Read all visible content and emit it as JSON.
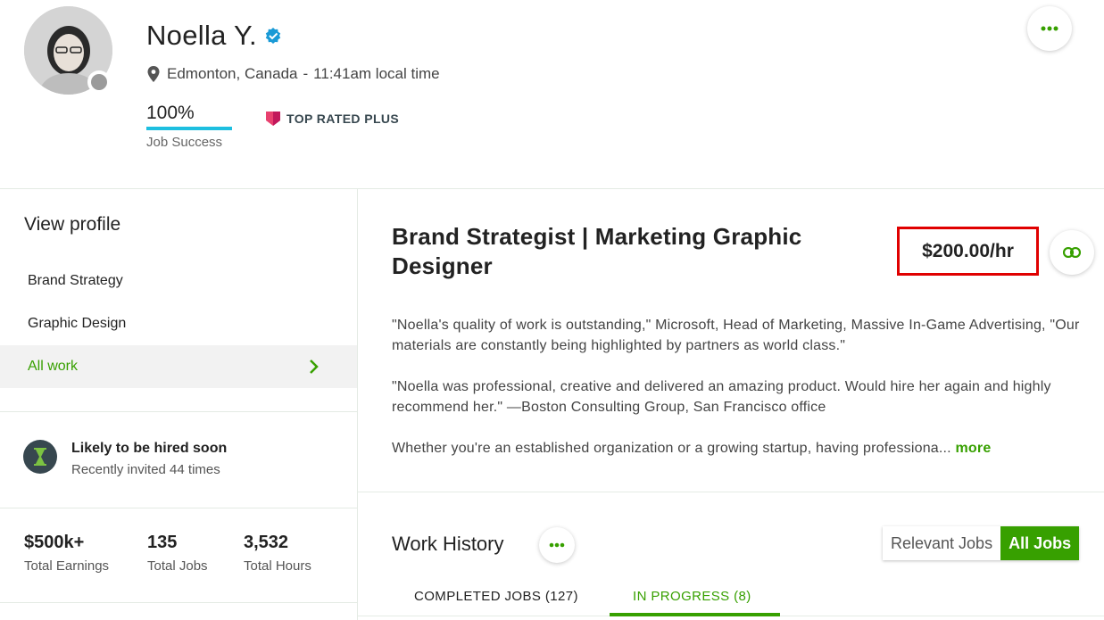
{
  "profile": {
    "name": "Noella Y.",
    "location": "Edmonton, Canada",
    "separator": "-",
    "local_time": "11:41am local time",
    "job_success_pct": "100%",
    "job_success_label": "Job Success",
    "badge": "TOP RATED PLUS"
  },
  "sidebar": {
    "title": "View profile",
    "items": [
      {
        "label": "Brand Strategy"
      },
      {
        "label": "Graphic Design"
      },
      {
        "label": "All work"
      }
    ],
    "hired": {
      "title": "Likely to be hired soon",
      "subtitle": "Recently invited 44 times"
    },
    "stats": [
      {
        "value": "$500k+",
        "label": "Total Earnings"
      },
      {
        "value": "135",
        "label": "Total Jobs"
      },
      {
        "value": "3,532",
        "label": "Total Hours"
      }
    ]
  },
  "main": {
    "title": "Brand Strategist | Marketing Graphic Designer",
    "rate": "$200.00/hr",
    "paragraphs": [
      "\"Noella's quality of work is outstanding,\" Microsoft, Head of Marketing, Massive In-Game Advertising, \"Our materials are constantly being highlighted by partners as world class.\"",
      "\"Noella was professional, creative and delivered an amazing product. Would hire her again and highly recommend her.\" —Boston Consulting Group, San Francisco office",
      "Whether you're an established organization or a growing startup, having professiona..."
    ],
    "more_label": "more",
    "work_history": {
      "title": "Work History",
      "toggle": [
        "Relevant Jobs",
        "All Jobs"
      ],
      "tabs": [
        "COMPLETED JOBS (127)",
        "IN PROGRESS (8)"
      ]
    }
  },
  "colors": {
    "accent_green": "#37a000",
    "job_success_bar": "#1dbfe0",
    "rate_highlight": "#e00000",
    "badge_pink": "#e8416f"
  }
}
